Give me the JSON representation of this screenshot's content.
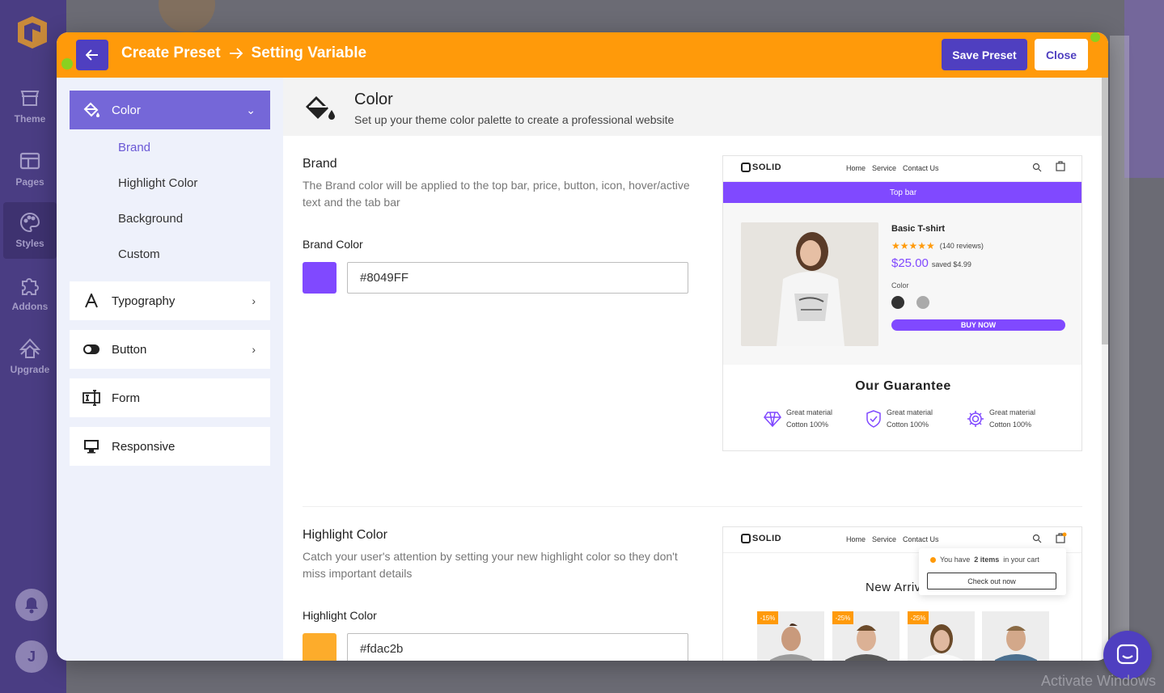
{
  "rail": {
    "items": [
      {
        "label": "Theme"
      },
      {
        "label": "Pages"
      },
      {
        "label": "Styles"
      },
      {
        "label": "Addons"
      },
      {
        "label": "Upgrade"
      }
    ],
    "avatar_initial": "J"
  },
  "header": {
    "title": "Create Preset",
    "subtitle": "Setting Variable",
    "save_label": "Save Preset",
    "close_label": "Close"
  },
  "sidebar": {
    "groups": [
      {
        "label": "Color",
        "icon": "paint-bucket-icon",
        "expanded": true
      },
      {
        "label": "Typography",
        "icon": "letter-a-icon"
      },
      {
        "label": "Button",
        "icon": "toggle-icon"
      },
      {
        "label": "Form",
        "icon": "form-field-icon"
      },
      {
        "label": "Responsive",
        "icon": "monitor-icon"
      }
    ],
    "color_items": [
      "Brand",
      "Highlight Color",
      "Background",
      "Custom"
    ]
  },
  "content": {
    "title": "Color",
    "subtitle": "Set up your theme color palette to create a professional website"
  },
  "brand": {
    "title": "Brand",
    "desc": "The Brand color will be applied to the top bar, price, button, icon, hover/active text and the tab bar",
    "field_label": "Brand Color",
    "value": "#8049FF",
    "swatch": "#8049ff"
  },
  "highlight": {
    "title": "Highlight Color",
    "desc": "Catch your user's attention by setting your new highlight color so they don't miss important details",
    "field_label": "Highlight Color",
    "value": "#fdac2b",
    "swatch": "#fdac2b"
  },
  "preview": {
    "logo": "SOLID",
    "nav": [
      "Home",
      "Service",
      "Contact Us"
    ],
    "topbar": "Top bar",
    "product_name": "Basic T-shirt",
    "stars": "★★★★★",
    "reviews": "(140 reviews)",
    "price": "$25.00",
    "saved": "saved $4.99",
    "color_label": "Color",
    "buy": "BUY NOW",
    "guarantee": "Our Guarantee",
    "g_items": [
      {
        "l1": "Great material",
        "l2": "Cotton 100%"
      },
      {
        "l1": "Great material",
        "l2": "Cotton 100%"
      },
      {
        "l1": "Great material",
        "l2": "Cotton 100%"
      }
    ],
    "popup_pre": "You have",
    "popup_items": "2 items",
    "popup_post": "in your cart",
    "checkout": "Check out now",
    "arrivals": "New Arriv",
    "badges": [
      "-15%",
      "-25%",
      "-25%"
    ]
  },
  "watermark": "Activate Windows",
  "colors": {
    "accent": "#ff9a0a",
    "primary": "#4f3fc0",
    "sidebar_active": "#7567d8"
  }
}
